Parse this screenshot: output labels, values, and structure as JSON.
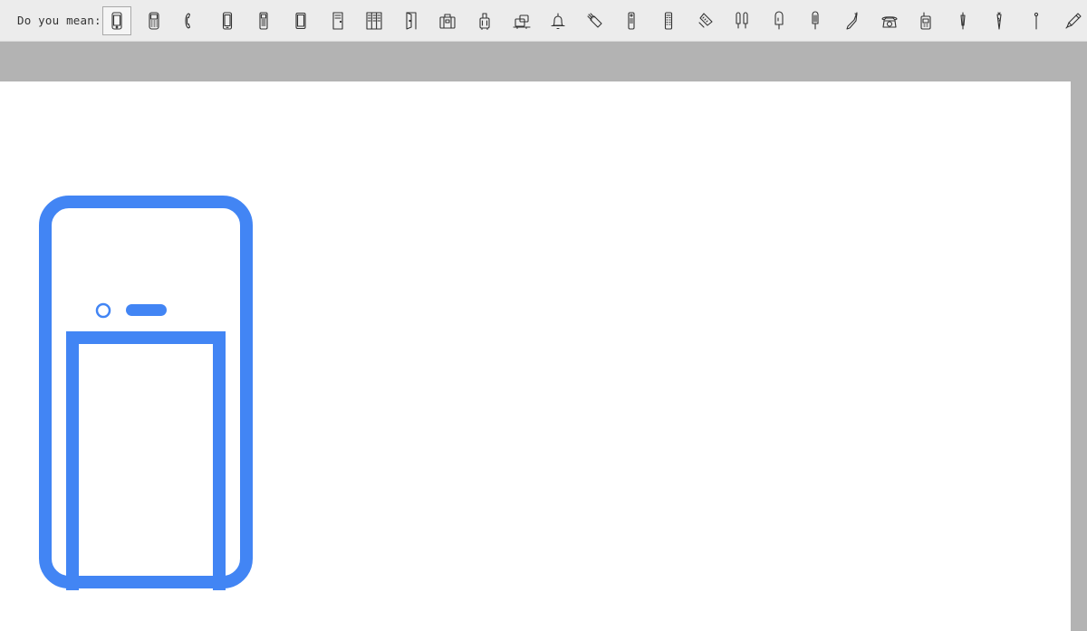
{
  "suggest_bar": {
    "label": "Do you mean:",
    "icon_color": "#333333",
    "suggestions": [
      {
        "icon": "smartphone-icon",
        "selected": true
      },
      {
        "icon": "feature-phone-icon",
        "selected": false
      },
      {
        "icon": "telephone-handset-icon",
        "selected": false
      },
      {
        "icon": "mobile-phone-icon",
        "selected": false
      },
      {
        "icon": "keypad-phone-icon",
        "selected": false
      },
      {
        "icon": "tablet-phone-icon",
        "selected": false
      },
      {
        "icon": "door-icon",
        "selected": false
      },
      {
        "icon": "lockers-icon",
        "selected": false
      },
      {
        "icon": "open-door-icon",
        "selected": false
      },
      {
        "icon": "luggage-icon",
        "selected": false
      },
      {
        "icon": "rolling-suitcase-icon",
        "selected": false
      },
      {
        "icon": "baggage-cart-icon",
        "selected": false
      },
      {
        "icon": "bell-icon",
        "selected": false
      },
      {
        "icon": "flashlight-icon",
        "selected": false
      },
      {
        "icon": "remote-control-icon",
        "selected": false
      },
      {
        "icon": "tv-remote-icon",
        "selected": false
      },
      {
        "icon": "walkie-remote-icon",
        "selected": false
      },
      {
        "icon": "popsicle-twin-icon",
        "selected": false
      },
      {
        "icon": "popsicle-icon",
        "selected": false
      },
      {
        "icon": "ice-pop-icon",
        "selected": false
      },
      {
        "icon": "ski-icon",
        "selected": false
      },
      {
        "icon": "rotary-telephone-icon",
        "selected": false
      },
      {
        "icon": "walkie-talkie-icon",
        "selected": false
      },
      {
        "icon": "pen-nib-icon",
        "selected": false
      },
      {
        "icon": "carrot-pen-icon",
        "selected": false
      },
      {
        "icon": "pin-icon",
        "selected": false
      },
      {
        "icon": "pencil-icon",
        "selected": false
      }
    ]
  },
  "preview": {
    "icon": "smartphone-icon",
    "color": "#4285f4"
  }
}
